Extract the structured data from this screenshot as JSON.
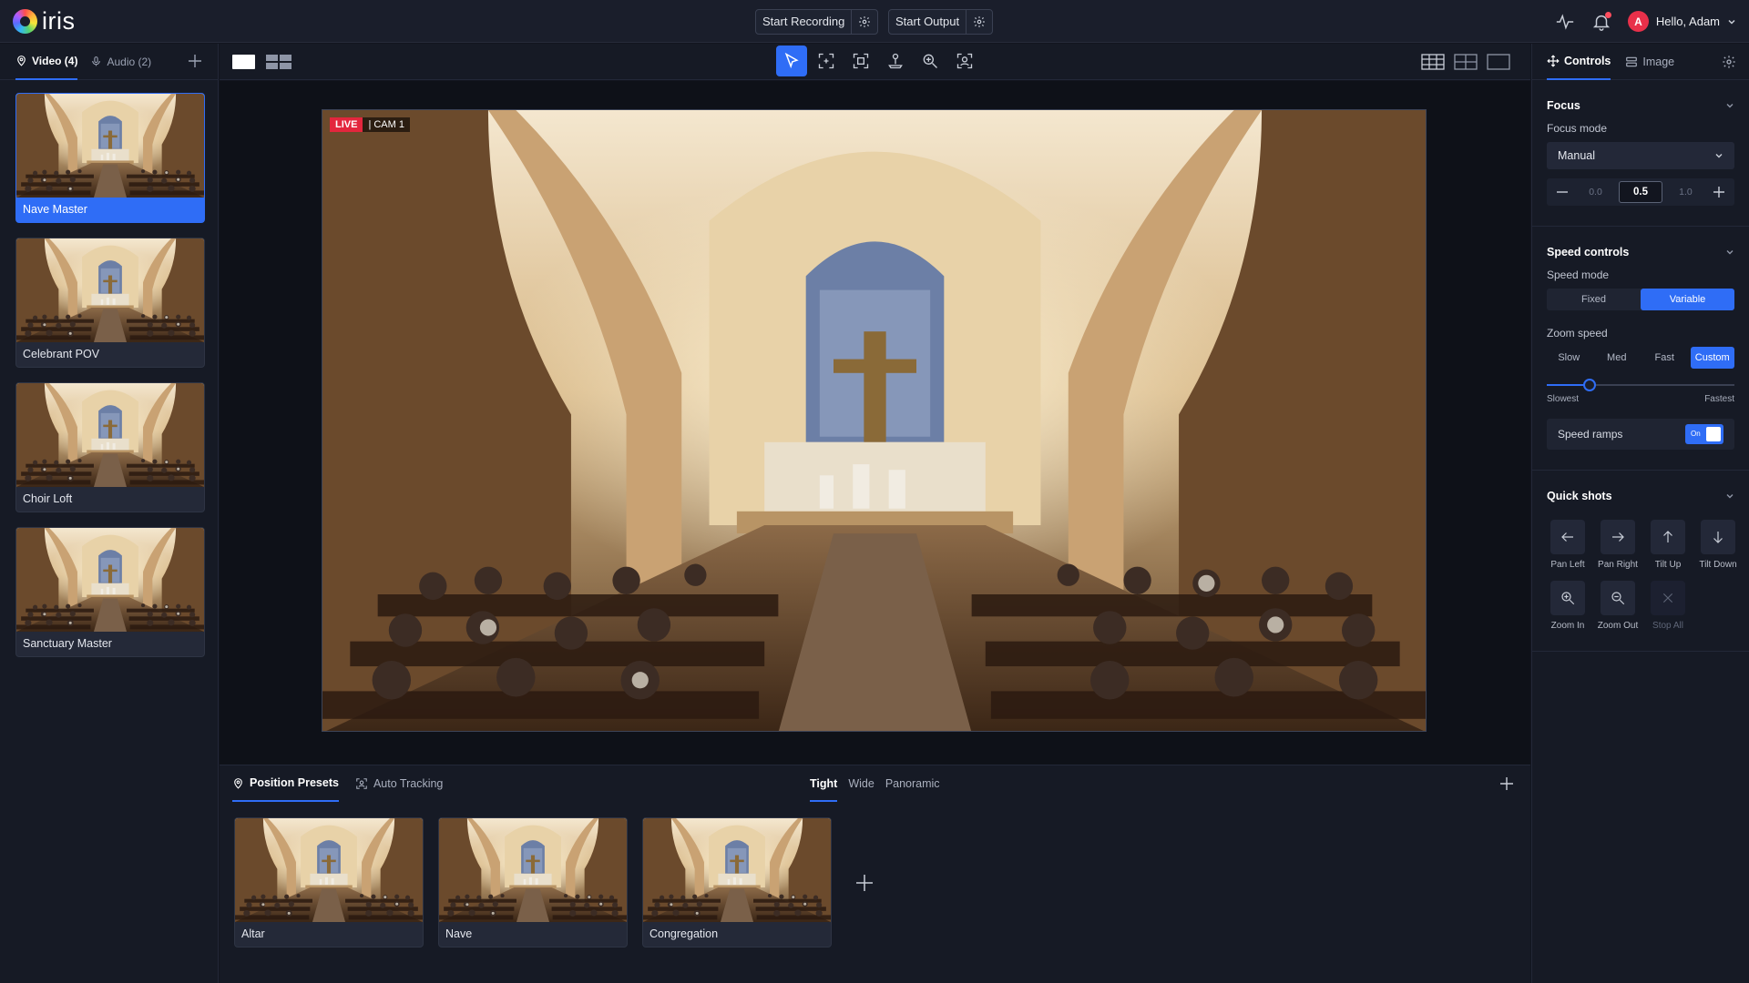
{
  "app": {
    "name": "iris"
  },
  "topbar": {
    "start_recording": "Start Recording",
    "start_output": "Start Output",
    "user_initial": "A",
    "greeting": "Hello, Adam"
  },
  "sidebar": {
    "tabs": [
      {
        "label": "Video (4)",
        "icon": "camera-pin-icon"
      },
      {
        "label": "Audio (2)",
        "icon": "mic-icon"
      }
    ],
    "cameras": [
      {
        "label": "Nave Master",
        "selected": true
      },
      {
        "label": "Celebrant POV",
        "selected": false
      },
      {
        "label": "Choir Loft",
        "selected": false
      },
      {
        "label": "Sanctuary Master",
        "selected": false
      }
    ]
  },
  "stage": {
    "live_label": "LIVE",
    "cam_label": "| CAM 1"
  },
  "presets": {
    "tabs": [
      {
        "label": "Position Presets",
        "active": true
      },
      {
        "label": "Auto Tracking",
        "active": false
      }
    ],
    "shot_tabs": [
      {
        "label": "Tight",
        "active": true
      },
      {
        "label": "Wide",
        "active": false
      },
      {
        "label": "Panoramic",
        "active": false
      }
    ],
    "items": [
      {
        "label": "Altar"
      },
      {
        "label": "Nave"
      },
      {
        "label": "Congregation"
      }
    ]
  },
  "rpanel": {
    "tabs": [
      {
        "label": "Controls",
        "active": true
      },
      {
        "label": "Image",
        "active": false
      }
    ],
    "focus": {
      "title": "Focus",
      "mode_label": "Focus mode",
      "mode_value": "Manual",
      "min": "0.0",
      "value": "0.5",
      "max": "1.0"
    },
    "speed": {
      "title": "Speed controls",
      "mode_label": "Speed mode",
      "modes": [
        "Fixed",
        "Variable"
      ],
      "active_mode": "Variable",
      "zoom_label": "Zoom speed",
      "zoom_options": [
        "Slow",
        "Med",
        "Fast",
        "Custom"
      ],
      "active_zoom": "Custom",
      "slider_value": 0.23,
      "slider_min_label": "Slowest",
      "slider_max_label": "Fastest",
      "ramps_label": "Speed ramps",
      "ramps_state": "On"
    },
    "quick": {
      "title": "Quick shots",
      "items": [
        {
          "label": "Pan Left",
          "icon": "arrow-left-icon"
        },
        {
          "label": "Pan Right",
          "icon": "arrow-right-icon"
        },
        {
          "label": "Tilt Up",
          "icon": "arrow-up-icon"
        },
        {
          "label": "Tilt Down",
          "icon": "arrow-down-icon"
        },
        {
          "label": "Zoom In",
          "icon": "zoom-in-icon"
        },
        {
          "label": "Zoom Out",
          "icon": "zoom-out-icon"
        },
        {
          "label": "Stop All",
          "icon": "close-icon"
        }
      ]
    }
  },
  "colors": {
    "accent": "#2f6df6",
    "live": "#e3263d",
    "background": "#12151f"
  }
}
